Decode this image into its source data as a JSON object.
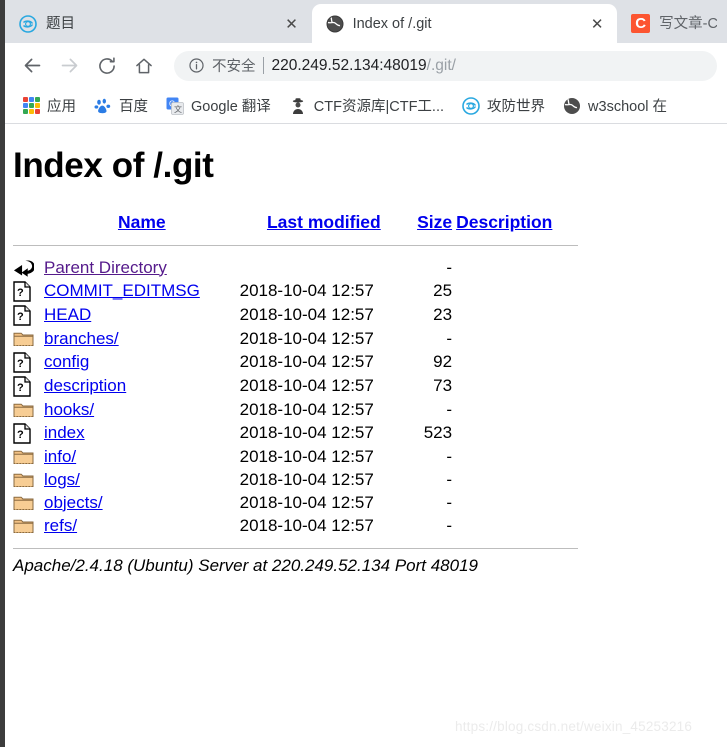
{
  "browser": {
    "tabs": [
      {
        "title": "题目",
        "favicon": "blue-circle-icon",
        "active": false,
        "close_label": "✕"
      },
      {
        "title": "Index of /.git",
        "favicon": "globe-icon",
        "active": true,
        "close_label": "✕"
      },
      {
        "title": "写文章-CSD",
        "favicon": "csdn-c-icon",
        "active": false,
        "close_label": "✕"
      }
    ],
    "nav": {
      "back": "back-arrow-icon",
      "forward": "forward-arrow-icon",
      "reload": "reload-icon",
      "home": "home-icon"
    },
    "omnibox": {
      "info_icon": "info-circle-icon",
      "security_label": "不安全",
      "url_host": "220.249.52.134:48019",
      "url_path": "/.git/"
    },
    "bookmarks": [
      {
        "label": "应用",
        "icon": "apps-grid-icon"
      },
      {
        "label": "百度",
        "icon": "baidu-paw-icon"
      },
      {
        "label": "Google 翻译",
        "icon": "google-translate-icon"
      },
      {
        "label": "CTF资源库|CTF工...",
        "icon": "detective-icon"
      },
      {
        "label": "攻防世界",
        "icon": "blue-circle-icon"
      },
      {
        "label": "w3school 在",
        "icon": "globe-icon"
      }
    ]
  },
  "page": {
    "title": "Index of /.git",
    "columns": {
      "name": "Name",
      "last_modified": "Last modified",
      "size": "Size",
      "description": "Description"
    },
    "rows": [
      {
        "icon": "back-directory-icon",
        "name": "Parent Directory",
        "visited": true,
        "date": "",
        "size": "-",
        "description": ""
      },
      {
        "icon": "unknown-file-icon",
        "name": "COMMIT_EDITMSG",
        "visited": false,
        "date": "2018-10-04 12:57",
        "size": "25",
        "description": ""
      },
      {
        "icon": "unknown-file-icon",
        "name": "HEAD",
        "visited": false,
        "date": "2018-10-04 12:57",
        "size": "23",
        "description": ""
      },
      {
        "icon": "folder-icon",
        "name": "branches/",
        "visited": false,
        "date": "2018-10-04 12:57",
        "size": "-",
        "description": ""
      },
      {
        "icon": "unknown-file-icon",
        "name": "config",
        "visited": false,
        "date": "2018-10-04 12:57",
        "size": "92",
        "description": ""
      },
      {
        "icon": "unknown-file-icon",
        "name": "description",
        "visited": false,
        "date": "2018-10-04 12:57",
        "size": "73",
        "description": ""
      },
      {
        "icon": "folder-icon",
        "name": "hooks/",
        "visited": false,
        "date": "2018-10-04 12:57",
        "size": "-",
        "description": ""
      },
      {
        "icon": "unknown-file-icon",
        "name": "index",
        "visited": false,
        "date": "2018-10-04 12:57",
        "size": "523",
        "description": ""
      },
      {
        "icon": "folder-icon",
        "name": "info/",
        "visited": false,
        "date": "2018-10-04 12:57",
        "size": "-",
        "description": ""
      },
      {
        "icon": "folder-icon",
        "name": "logs/",
        "visited": false,
        "date": "2018-10-04 12:57",
        "size": "-",
        "description": ""
      },
      {
        "icon": "folder-icon",
        "name": "objects/",
        "visited": false,
        "date": "2018-10-04 12:57",
        "size": "-",
        "description": ""
      },
      {
        "icon": "folder-icon",
        "name": "refs/",
        "visited": false,
        "date": "2018-10-04 12:57",
        "size": "-",
        "description": ""
      }
    ],
    "server_signature": "Apache/2.4.18 (Ubuntu) Server at 220.249.52.134 Port 48019",
    "watermark": "https://blog.csdn.net/weixin_45253216"
  },
  "colors": {
    "link": "#0000ee",
    "visited_link": "#551a8b",
    "tabstrip_bg": "#dee1e6",
    "omnibox_bg": "#f1f3f4",
    "csdn_red": "#fc5531",
    "folder": "#f0c080"
  }
}
